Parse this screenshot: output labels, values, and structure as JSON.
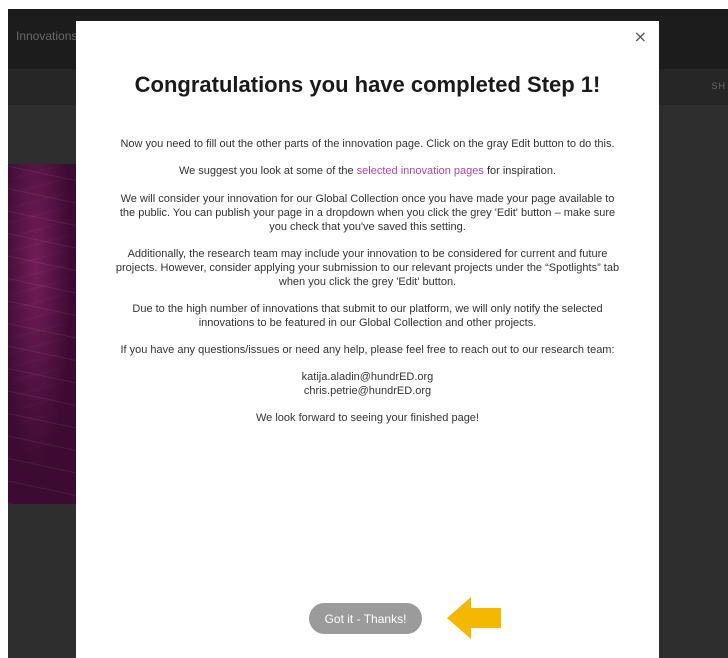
{
  "background_page": {
    "top_bar_brand": "Innovations",
    "sub_bar_right": "SH"
  },
  "modal": {
    "close_symbol": "×",
    "title": "Congratulations you have completed Step 1!",
    "paragraph_1": "Now you need to fill out the other parts of the innovation page. Click on the gray Edit button to do this.",
    "paragraph_2_prefix": "We suggest you look at some of the ",
    "paragraph_2_link": "selected innovation pages",
    "paragraph_2_suffix": " for inspiration.",
    "paragraph_3": "We will consider your innovation for our Global Collection once you have made your page available to the public. You can publish your page in a dropdown when you click the grey 'Edit' button – make sure you check that you've saved this setting.",
    "paragraph_4": "Additionally, the research team may include your innovation to be considered for current and future projects. However, consider applying your submission to our relevant projects under the “Spotlights” tab when you click the grey 'Edit' button.",
    "paragraph_5": "Due to the high number of innovations that submit to our platform, we will only notify the selected innovations to be featured in our Global Collection and other projects.",
    "paragraph_6": "If you have any questions/issues or need any help, please feel free to reach out to our research team:",
    "contacts": [
      "katija.aladin@hundrED.org",
      "chris.petrie@hundrED.org"
    ],
    "closing": "We look forward to seeing your finished page!",
    "button_label": "Got it - Thanks!"
  },
  "colors": {
    "link": "#b0479a",
    "button": "#9b9b9b",
    "arrow": "#f5b800",
    "overlay": "#2e2e2e"
  },
  "icons": {
    "close": "close-icon",
    "arrow": "arrow-left-icon"
  }
}
